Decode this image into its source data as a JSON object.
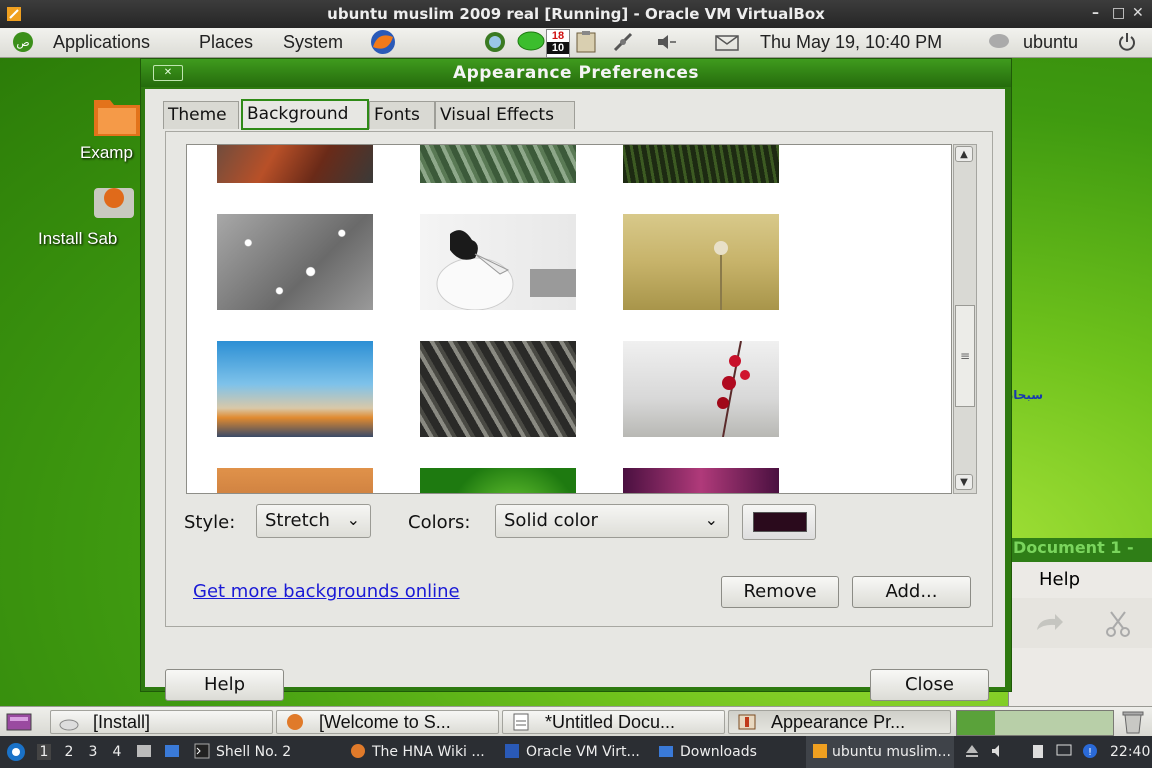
{
  "host_window": {
    "title": "ubuntu muslim 2009 real [Running] - Oracle VM VirtualBox",
    "buttons": [
      "–",
      "□",
      "✕"
    ]
  },
  "top_panel": {
    "menus": [
      "Applications",
      "Places",
      "System"
    ],
    "calendar_day_top": "18",
    "calendar_day_bottom": "10",
    "datetime": "Thu May 19, 10:40 PM",
    "user": "ubuntu"
  },
  "desktop": {
    "icons": [
      "Examp",
      "Install Sab"
    ],
    "arabic_text": "سبحان الله"
  },
  "background_window": {
    "title": "Document 1 -",
    "menu_help": "Help"
  },
  "dialog": {
    "title": "Appearance Preferences",
    "tabs": [
      "Theme",
      "Background",
      "Fonts",
      "Visual Effects"
    ],
    "active_tab": "Background",
    "style_label": "Style:",
    "style_value": "Stretch",
    "colors_label": "Colors:",
    "colors_value": "Solid color",
    "color_swatch": "#2a0a1c",
    "link_text": "Get more backgrounds online",
    "remove_label": "Remove",
    "add_label": "Add...",
    "help_label": "Help",
    "close_label": "Close"
  },
  "bottom_panel": {
    "tasks": [
      "[Install]",
      "[Welcome to S...",
      "*Untitled Docu...",
      "Appearance Pr..."
    ]
  },
  "host_taskbar": {
    "workspaces": [
      "1",
      "2",
      "3",
      "4"
    ],
    "items": [
      "Shell No. 2",
      "The HNA Wiki ...",
      "Oracle VM Virt...",
      "Downloads",
      "ubuntu muslim..."
    ],
    "clock": "22:40"
  }
}
